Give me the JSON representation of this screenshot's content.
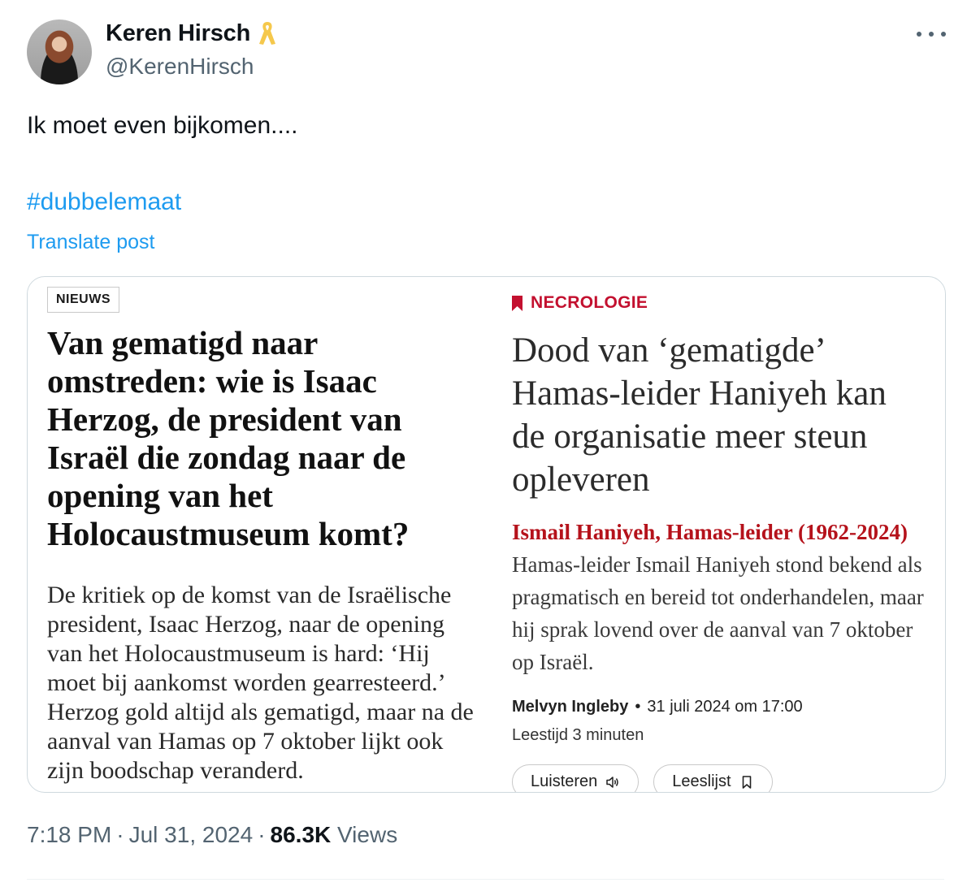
{
  "author": {
    "display_name": "Keren Hirsch",
    "handle": "@KerenHirsch",
    "badge_icon": "yellow-ribbon-icon"
  },
  "tweet": {
    "text": "Ik moet even bijkomen....",
    "hashtag": "#dubbelemaat",
    "translate_label": "Translate post"
  },
  "embedded_image": {
    "left_article": {
      "section_label": "NIEUWS",
      "headline": "Van gematigd naar omstreden: wie is Isaac Herzog, de president van Israël die zondag naar de opening van het Holocaustmuseum komt?",
      "body": "De kritiek op de komst van de Israëlische president, Isaac Herzog, naar de opening van het Holocaustmuseum is hard: ‘Hij moet bij aankomst worden gearresteerd.’ Herzog gold altijd als gematigd, maar na de aanval van Hamas op 7 oktober lijkt ook zijn boodschap veranderd."
    },
    "right_article": {
      "section_label": "NECROLOGIE",
      "headline": "Dood van ‘gematigde’ Hamas-leider Haniyeh kan de organisatie meer steun opleveren",
      "lede_highlight": "Ismail Haniyeh, Hamas-leider (1962-2024)",
      "lede_text": "Hamas-leider Ismail Haniyeh stond bekend als pragmatisch en bereid tot onderhandelen, maar hij sprak lovend over de aanval van 7 oktober op Israël.",
      "author": "Melvyn Ingleby",
      "date": "31 juli 2024 om 17:00",
      "read_time": "Leestijd 3 minuten",
      "listen_label": "Luisteren",
      "reading_list_label": "Leeslijst"
    }
  },
  "meta": {
    "time": "7:18 PM",
    "date": "Jul 31, 2024",
    "views_count": "86.3K",
    "views_label": "Views"
  },
  "colors": {
    "link": "#1d9bf0",
    "secondary_text": "#536471",
    "necrologie_red": "#c3102f"
  }
}
